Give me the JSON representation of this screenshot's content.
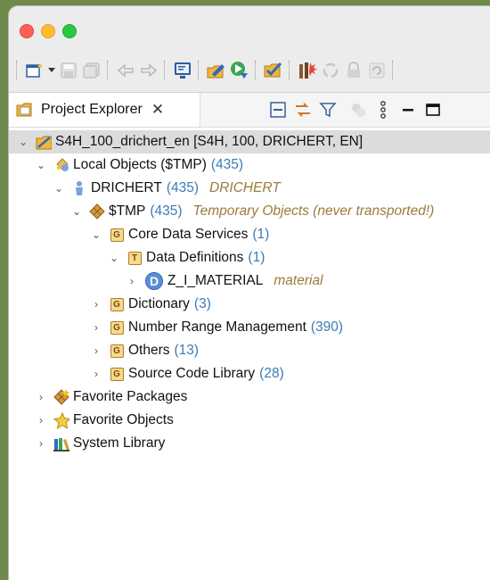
{
  "toolbar": {
    "icons": [
      "new-wizard-icon",
      "dropdown-arrow-icon",
      "save-icon",
      "save-all-icon",
      "back-icon",
      "forward-icon",
      "console-icon",
      "open-abap-development-object-icon",
      "run-icon",
      "activate-icon",
      "abap-unit-icon",
      "sync-icon",
      "lock-icon",
      "refresh-icon"
    ]
  },
  "view": {
    "tab_label": "Project Explorer",
    "tab_close": "✕",
    "actions": [
      "collapse-all-icon",
      "link-with-editor-icon",
      "filter-icon",
      "filters-icon",
      "view-menu-icon",
      "minimize-icon",
      "maximize-icon"
    ]
  },
  "tree": {
    "project": {
      "label": "S4H_100_drichert_en [S4H, 100, DRICHERT, EN]"
    },
    "local_objects": {
      "label": "Local Objects ($TMP)",
      "count": "(435)"
    },
    "user": {
      "label": "DRICHERT",
      "count": "(435)",
      "desc": "DRICHERT"
    },
    "tmp": {
      "label": "$TMP",
      "count": "(435)",
      "desc": "Temporary Objects (never transported!)"
    },
    "cds": {
      "label": "Core Data Services",
      "count": "(1)"
    },
    "datadefs": {
      "label": "Data Definitions",
      "count": "(1)"
    },
    "zimaterial": {
      "label": "Z_I_MATERIAL",
      "desc": "material"
    },
    "dictionary": {
      "label": "Dictionary",
      "count": "(3)"
    },
    "number_range": {
      "label": "Number Range Management",
      "count": "(390)"
    },
    "others": {
      "label": "Others",
      "count": "(13)"
    },
    "source_code": {
      "label": "Source Code Library",
      "count": "(28)"
    },
    "fav_packages": {
      "label": "Favorite Packages"
    },
    "fav_objects": {
      "label": "Favorite Objects"
    },
    "system_library": {
      "label": "System Library"
    }
  },
  "colors": {
    "count": "#3b7bb7",
    "description": "#9a7b3c",
    "selection": "#dcdcdc"
  }
}
